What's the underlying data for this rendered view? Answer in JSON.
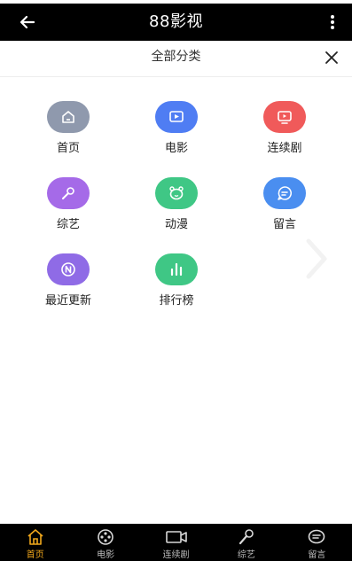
{
  "header": {
    "title": "88影视"
  },
  "subheader": {
    "label": "全部分类"
  },
  "categories": [
    {
      "label": "首页",
      "icon": "home-icon",
      "color": "#8f99ad"
    },
    {
      "label": "电影",
      "icon": "film-icon",
      "color": "#4f7df3"
    },
    {
      "label": "连续剧",
      "icon": "tv-icon",
      "color": "#f05a5a"
    },
    {
      "label": "综艺",
      "icon": "microphone-icon",
      "color": "#a56ae8"
    },
    {
      "label": "动漫",
      "icon": "bear-icon",
      "color": "#3fc785"
    },
    {
      "label": "留言",
      "icon": "message-icon",
      "color": "#4a8ef0"
    },
    {
      "label": "最近更新",
      "icon": "new-icon",
      "color": "#8f6be6"
    },
    {
      "label": "排行榜",
      "icon": "bar-chart-icon",
      "color": "#3fc785"
    }
  ],
  "bottom_nav": {
    "items": [
      {
        "label": "首页",
        "icon": "home-icon",
        "active": true
      },
      {
        "label": "电影",
        "icon": "film-reel-icon",
        "active": false
      },
      {
        "label": "连续剧",
        "icon": "video-camera-icon",
        "active": false
      },
      {
        "label": "综艺",
        "icon": "microphone-icon",
        "active": false
      },
      {
        "label": "留言",
        "icon": "message-icon",
        "active": false
      }
    ]
  },
  "colors": {
    "active": "#f0a71c",
    "bar": "#000000",
    "inactive": "#bdbdbd"
  }
}
